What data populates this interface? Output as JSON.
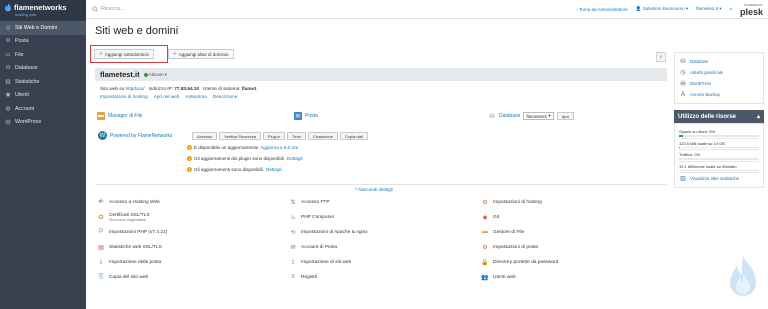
{
  "sidebar": {
    "brand": "flamenetworks",
    "brand_tag": "hosting web",
    "items": [
      {
        "label": "Siti Web e Domini",
        "icon": "globe-icon",
        "active": true
      },
      {
        "label": "Posta",
        "icon": "mail-icon"
      },
      {
        "label": "File",
        "icon": "folder-icon"
      },
      {
        "label": "Database",
        "icon": "database-icon"
      },
      {
        "label": "Statistiche",
        "icon": "chart-icon"
      },
      {
        "label": "Utenti",
        "icon": "user-icon"
      },
      {
        "label": "Account",
        "icon": "account-icon"
      },
      {
        "label": "WordPress",
        "icon": "wordpress-icon"
      }
    ]
  },
  "topbar": {
    "search_placeholder": "Ricerca...",
    "back_admin": "Torna ad Amministratore",
    "user": "Salvatore Buonuomo",
    "site": "flametest.it",
    "help": "?",
    "powered_by": "POWERED BY",
    "plesk": "plesk"
  },
  "page": {
    "title": "Siti web e domini",
    "add_subdomain": "Aggiungi sottodominio",
    "add_alias": "Aggiungi alias di dominio"
  },
  "domain": {
    "name": "flametest.it",
    "status": "Attivato",
    "site_at": "Sito web su",
    "httpdocs": "httpdocs/",
    "ip_label": "Indirizzo IP:",
    "ip": "77.83.64.10",
    "sysuser_label": "Utente di sistema:",
    "sysuser": "flame1",
    "links": [
      "Impostazioni di hosting",
      "Apri nel web",
      "Anteprima",
      "Descrizione"
    ],
    "file_manager": "Manager di File",
    "mail": "Posta",
    "database": "Database",
    "db_select": "flametest1",
    "open_btn": "Apri",
    "wp_powered": "Powered by FlameNetworks",
    "wp_tabs": [
      "Accesso",
      "Verifica Sicurezza",
      "Plug-in",
      "Temi",
      "Clonazione",
      "Copia dati"
    ],
    "updates": [
      {
        "text": "È disponibile un aggiornamento",
        "link": "Aggiorna a 6.0 ora"
      },
      {
        "text": "Gli aggiornamenti dei plugin sono disponibili.",
        "link": "Dettagli"
      },
      {
        "text": "Gli aggiornamenti sono disponibili.",
        "link": "Dettagli"
      }
    ],
    "hide_details": "Nascondi dettagli"
  },
  "tools": [
    {
      "label": "Accesso a Hosting Web",
      "icon": "hosting-access-icon",
      "color": "#3a6fb0"
    },
    {
      "label": "Accesso FTP",
      "icon": "ftp-icon",
      "color": "#6b7c8f"
    },
    {
      "label": "Impostazioni di hosting",
      "icon": "hosting-settings-icon",
      "color": "#c8762b"
    },
    {
      "label": "Certificati SSL/TLS",
      "sub": "Sicurezza migliorabile",
      "icon": "certificate-icon",
      "color": "#d59b2b"
    },
    {
      "label": "PHP Composer",
      "icon": "php-composer-icon",
      "color": "#5b4632"
    },
    {
      "label": "Git",
      "icon": "git-icon",
      "color": "#e05a2f"
    },
    {
      "label": "Impostazioni PHP (v7.4.21)",
      "icon": "php-icon",
      "color": "#7a86b8"
    },
    {
      "label": "Impostazioni di Apache & nginx",
      "icon": "apache-nginx-icon",
      "color": "#4c8fc7"
    },
    {
      "label": "Gestore di File",
      "icon": "file-manager-icon",
      "color": "#e8a33b"
    },
    {
      "label": "Statistiche web SSL/TLS",
      "icon": "web-stats-icon",
      "color": "#c94646"
    },
    {
      "label": "Account di Posta",
      "icon": "mail-account-icon",
      "color": "#3a86c8"
    },
    {
      "label": "Impostazioni di posta",
      "icon": "mail-settings-icon",
      "color": "#d06b3a"
    },
    {
      "label": "Importazione della posta",
      "icon": "mail-import-icon",
      "color": "#6b7c8f"
    },
    {
      "label": "Importazione di siti web",
      "icon": "site-import-icon",
      "color": "#2e9ec2"
    },
    {
      "label": "Directory protette da password",
      "icon": "protected-dir-icon",
      "color": "#c8762b"
    },
    {
      "label": "Copia del sito web",
      "icon": "site-copy-icon",
      "color": "#4c8fc7"
    },
    {
      "label": "Registri",
      "icon": "logs-icon",
      "color": "#6b7c8f"
    },
    {
      "label": "Utenti web",
      "icon": "web-users-icon",
      "color": "#3a86c8"
    }
  ],
  "right": {
    "links": [
      {
        "label": "Database",
        "icon": "database-icon"
      },
      {
        "label": "Attività pianificate",
        "icon": "schedule-icon"
      },
      {
        "label": "WordPress",
        "icon": "wordpress-icon"
      },
      {
        "label": "Acronis Backup",
        "icon": "acronis-icon"
      }
    ],
    "usage_title": "Utilizzo delle risorse",
    "usage": [
      {
        "text": "Spazio su disco: 5%",
        "pct": 5
      },
      {
        "text": "123.5 MB usate su 10 GB",
        "pct": 1.2
      },
      {
        "text": "Traffico: 0%",
        "pct": 0
      },
      {
        "text": "19.1 MB/mese usate su illimitato",
        "pct": 0
      }
    ],
    "stats_link": "Visualizza altre statistiche"
  },
  "colors": {
    "sidebar": "#374150",
    "accent": "#1878b8",
    "highlight": "#d23b3b"
  }
}
